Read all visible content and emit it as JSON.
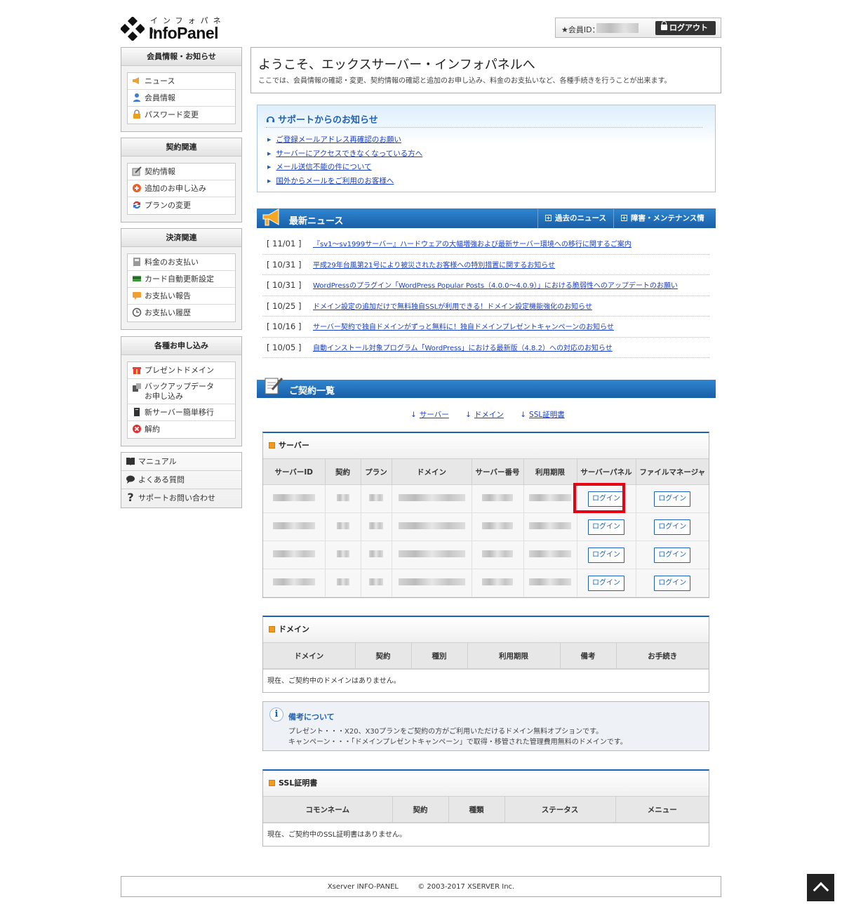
{
  "header": {
    "logo_kana": "インフォパネル",
    "logo_name": "InfoPanel",
    "member_label": "★会員ID：",
    "logout_label": "ログアウト"
  },
  "sidebar": {
    "sections": [
      {
        "title": "会員情報・お知らせ",
        "items": [
          "ニュース",
          "会員情報",
          "パスワード変更"
        ]
      },
      {
        "title": "契約関連",
        "items": [
          "契約情報",
          "追加のお申し込み",
          "プランの変更"
        ]
      },
      {
        "title": "決済関連",
        "items": [
          "料金のお支払い",
          "カード自動更新設定",
          "お支払い報告",
          "お支払い履歴"
        ]
      },
      {
        "title": "各種お申し込み",
        "items": [
          "プレゼントドメイン",
          "バックアップデータ",
          "お申し込み",
          "新サーバー簡単移行",
          "解約"
        ]
      }
    ],
    "links": [
      "マニュアル",
      "よくある質問",
      "サポートお問い合わせ"
    ]
  },
  "welcome": {
    "title": "ようこそ、エックスサーバー・インフォパネルへ",
    "desc": "ここでは、会員情報の確認・変更、契約情報の確認と追加のお申し込み、料金のお支払いなど、各種手続きを行うことが出来ます。"
  },
  "support": {
    "title": "サポートからのお知らせ",
    "items": [
      "ご登録メールアドレス再確認のお願い",
      "サーバーにアクセスできなくなっている方へ",
      "メール送信不能の件について",
      "国外からメールをご利用のお客様へ"
    ]
  },
  "news": {
    "title": "最新ニュース",
    "tab_past": "過去のニュース",
    "tab_trouble": "障害・メンテナンス情報",
    "items": [
      {
        "date": "[ 11/01 ]",
        "text": "『sv1～sv1999サーバー』ハードウェアの大幅増強および最新サーバー環境への移行に関するご案内"
      },
      {
        "date": "[ 10/31 ]",
        "text": "平成29年台風第21号により被災されたお客様への特別措置に関するお知らせ"
      },
      {
        "date": "[ 10/31 ]",
        "text": "WordPressのプラグイン「WordPress Popular Posts（4.0.0～4.0.9）」における脆弱性へのアップデートのお願い"
      },
      {
        "date": "[ 10/25 ]",
        "text": "ドメイン設定の追加だけで無料独自SSLが利用できる！ドメイン設定機能強化のお知らせ"
      },
      {
        "date": "[ 10/16 ]",
        "text": "サーバー契約で独自ドメインがずっと無料に！独自ドメインプレゼントキャンペーンのお知らせ"
      },
      {
        "date": "[ 10/05 ]",
        "text": "自動インストール対象プログラム「WordPress」における最新版（4.8.2）への対応のお知らせ"
      }
    ]
  },
  "contracts": {
    "title": "ご契約一覧",
    "jump": [
      "サーバー",
      "ドメイン",
      "SSL証明書"
    ],
    "jump_arrow": "↓",
    "server": {
      "caption": "サーバー",
      "headers": [
        "サーバーID",
        "契約",
        "プラン",
        "ドメイン",
        "サーバー番号",
        "利用期限",
        "サーバーパネル",
        "ファイルマネージャ"
      ],
      "login_label": "ログイン",
      "row_count_label": ""
    },
    "domain": {
      "caption": "ドメイン",
      "headers": [
        "ドメイン",
        "契約",
        "種別",
        "利用期限",
        "備考",
        "お手続き"
      ],
      "empty": "現在、ご契約中のドメインはありません。"
    },
    "note": {
      "icon": "i",
      "title": "備考について",
      "line1": "プレゼント・・・X20、X30プランをご契約の方がご利用いただけるドメイン無料オプションです。",
      "line2": "キャンペーン・・・「ドメインプレゼントキャンペーン」で取得・移管された管理費用無料のドメインです。"
    },
    "ssl": {
      "caption": "SSL証明書",
      "headers": [
        "コモンネーム",
        "契約",
        "種類",
        "ステータス",
        "メニュー"
      ],
      "empty": "現在、ご契約中のSSL証明書はありません。"
    }
  },
  "footer": {
    "left": "Xserver INFO-PANEL",
    "right": "© 2003-2017 XSERVER Inc."
  },
  "colors": {
    "accent": "#1d62b8",
    "highlight": "#e60012"
  }
}
